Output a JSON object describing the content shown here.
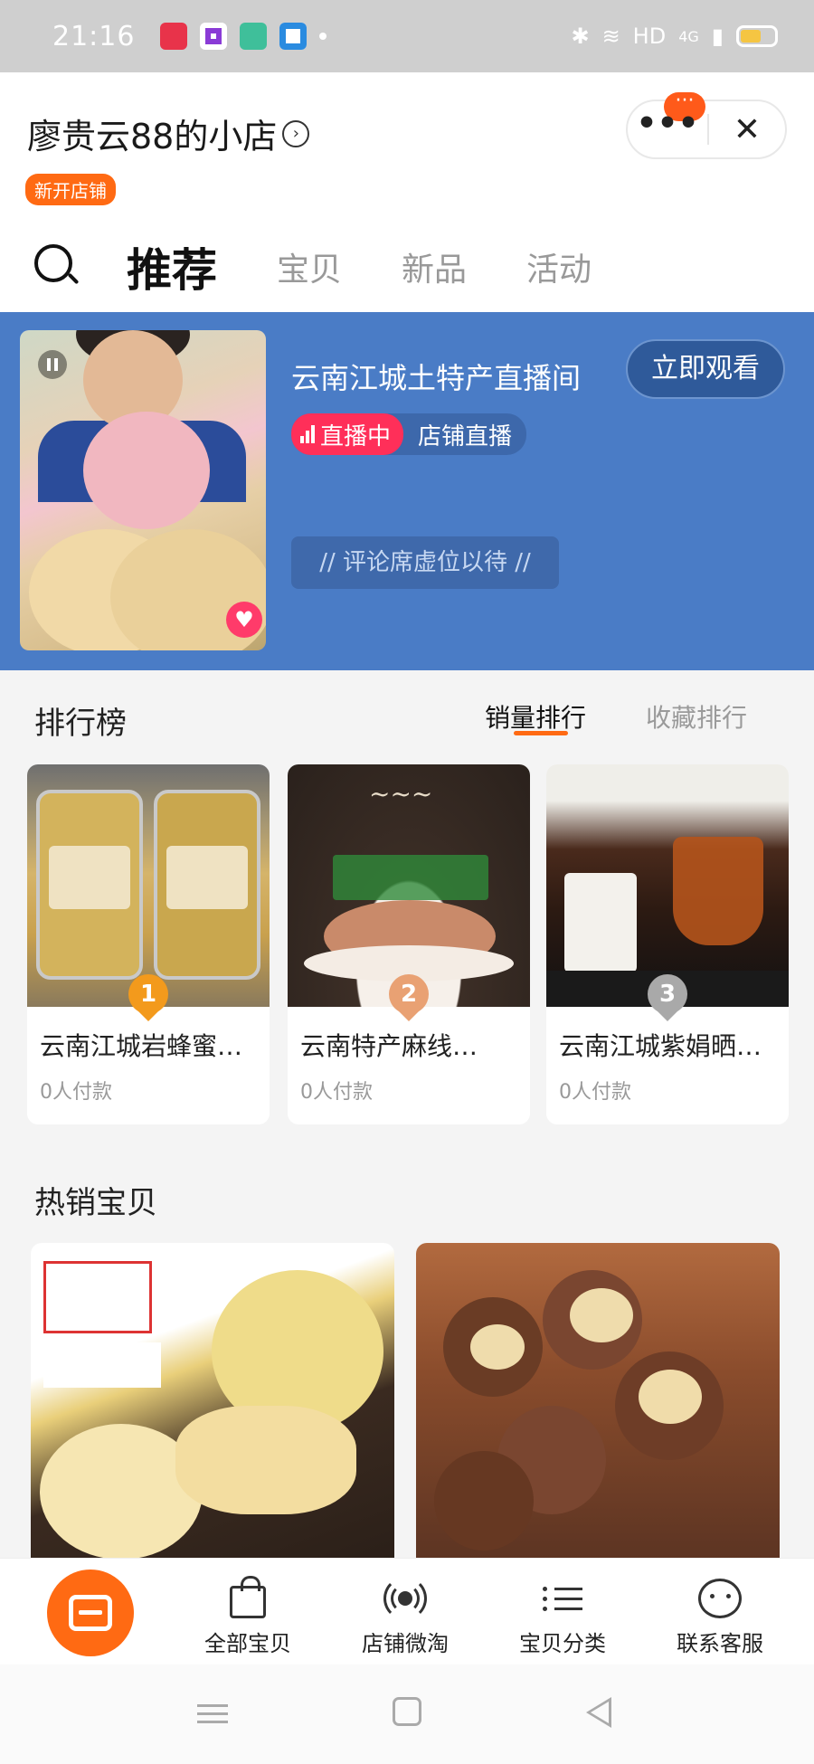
{
  "status_bar": {
    "time": "21:16",
    "network": "HD",
    "signal": "4G",
    "icons": [
      "bluetooth-icon",
      "wifi-icon",
      "signal-icon",
      "battery-icon"
    ]
  },
  "header": {
    "shop_name": "廖贵云88的小店",
    "new_badge": "新开店铺",
    "more_label": "•••",
    "notif_label": "···",
    "close_label": "✕",
    "tabs": [
      "推荐",
      "宝贝",
      "新品",
      "活动"
    ]
  },
  "live": {
    "title": "云南江城土特产直播间",
    "watch_button": "立即观看",
    "status": "直播中",
    "type": "店铺直播",
    "comment_placeholder": "// 评论席虚位以待 //"
  },
  "ranking": {
    "title": "排行榜",
    "tabs": [
      "销量排行",
      "收藏排行"
    ],
    "items": [
      {
        "rank": "1",
        "name": "云南江城岩蜂蜜…",
        "sold": "0人付款",
        "medal_color": "#f39a1c"
      },
      {
        "rank": "2",
        "name": "云南特产麻线…",
        "sold": "0人付款",
        "medal_color": "#e9a173"
      },
      {
        "rank": "3",
        "name": "云南江城紫娟晒…",
        "sold": "0人付款",
        "medal_color": "#a9a9a9"
      }
    ]
  },
  "hot": {
    "title": "热销宝贝"
  },
  "bottom_bar": {
    "items": [
      "全部宝贝",
      "店铺微淘",
      "宝贝分类",
      "联系客服"
    ]
  },
  "colors": {
    "accent": "#ff6a13",
    "live_bg": "#4a7cc6",
    "live_badge": "#ff2f59"
  }
}
